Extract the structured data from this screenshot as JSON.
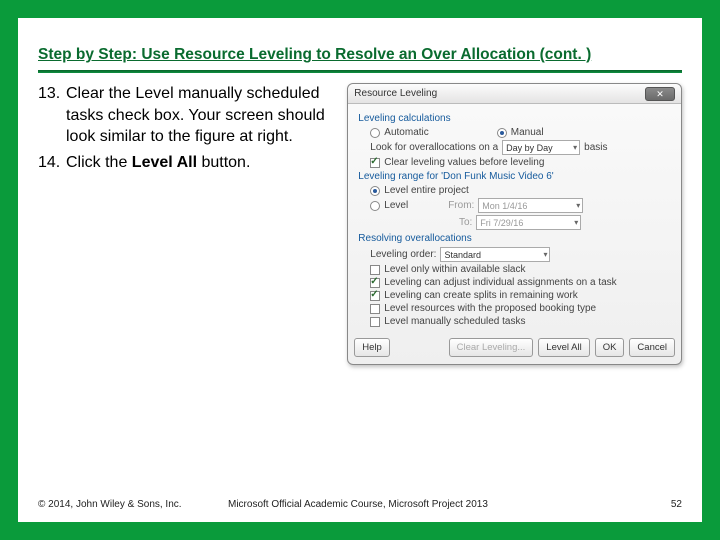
{
  "title": "Step by Step: Use Resource Leveling to Resolve an Over Allocation (cont. )",
  "steps": {
    "s13_num": "13.",
    "s13_a": "Clear the Level manually scheduled tasks check box. Your screen should look similar to the figure at right.",
    "s14_num": "14.",
    "s14_a": "Click the ",
    "s14_b": "Level All",
    "s14_c": " button."
  },
  "dialog": {
    "title": "Resource Leveling",
    "sec_calc": "Leveling calculations",
    "automatic": "Automatic",
    "manual": "Manual",
    "look_for": "Look for overallocations on a",
    "basis_combo": "Day by Day",
    "basis_suffix": "basis",
    "clear_values": "Clear leveling values before leveling",
    "sec_range": "Leveling range for 'Don Funk Music Video 6'",
    "level_entire": "Level entire project",
    "level": "Level",
    "from_lbl": "From:",
    "from_val": "Mon 1/4/16",
    "to_lbl": "To:",
    "to_val": "Fri 7/29/16",
    "sec_resolve": "Resolving overallocations",
    "order_lbl": "Leveling order:",
    "order_combo": "Standard",
    "opt1": "Level only within available slack",
    "opt2": "Leveling can adjust individual assignments on a task",
    "opt3": "Leveling can create splits in remaining work",
    "opt4": "Level resources with the proposed booking type",
    "opt5": "Level manually scheduled tasks",
    "btn_help": "Help",
    "btn_clear": "Clear Leveling...",
    "btn_all": "Level All",
    "btn_ok": "OK",
    "btn_cancel": "Cancel"
  },
  "footer": {
    "copyright": "© 2014, John Wiley & Sons, Inc.",
    "course": "Microsoft Official Academic Course, Microsoft Project 2013",
    "page": "52"
  }
}
